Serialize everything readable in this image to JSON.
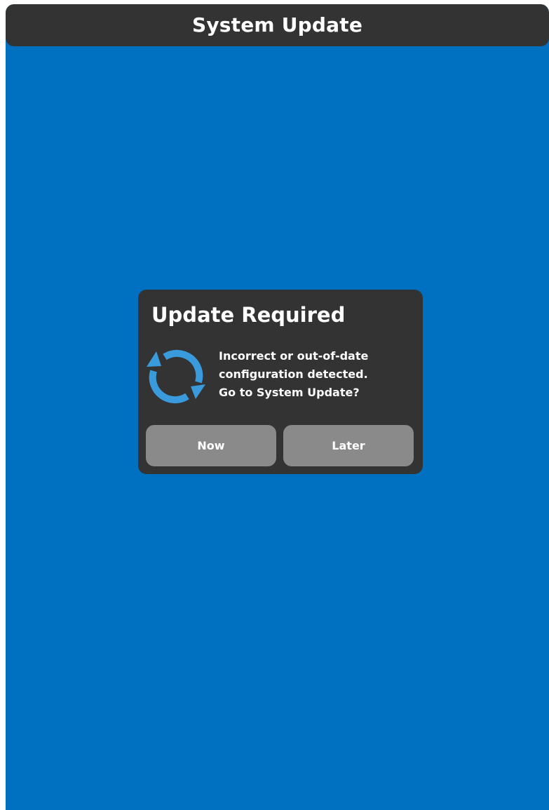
{
  "window": {
    "title": "System Update"
  },
  "dialog": {
    "title": "Update Required",
    "icon": "refresh-icon",
    "message_lines": [
      "Incorrect or out-of-date",
      "configuration detected.",
      "Go to System Update?"
    ],
    "buttons": {
      "now_label": "Now",
      "later_label": "Later"
    }
  },
  "colors": {
    "background": "#0070c0",
    "panel": "#333333",
    "button": "#8a8a8a",
    "icon": "#3a9bdc",
    "text": "#ffffff"
  }
}
